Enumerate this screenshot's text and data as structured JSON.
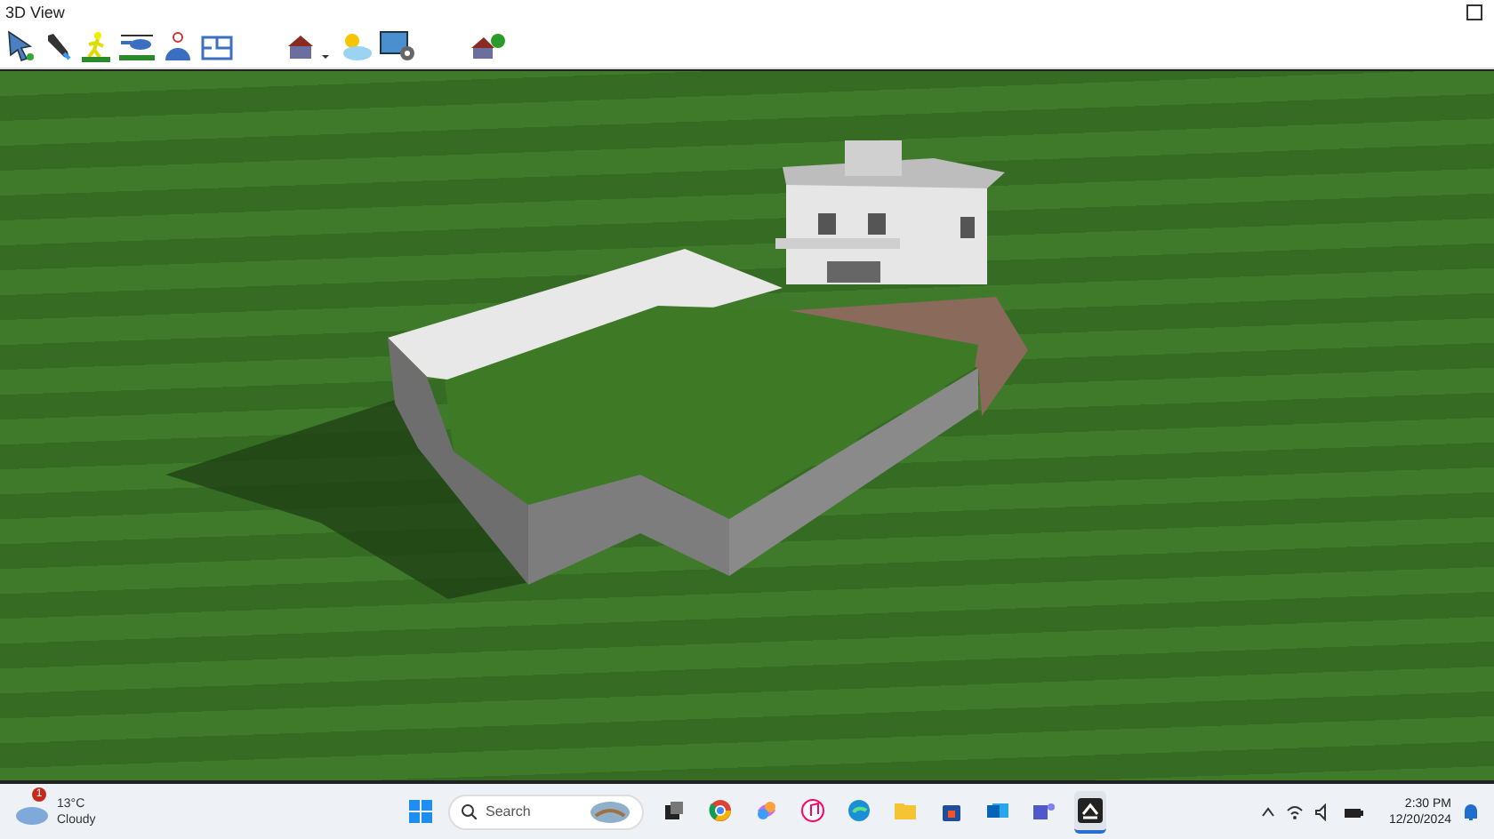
{
  "window": {
    "title": "3D View"
  },
  "taskbar": {
    "weather": {
      "badge": "1",
      "temperature": "13°C",
      "condition": "Cloudy"
    },
    "search": {
      "placeholder": "Search"
    },
    "apps": [
      {
        "kind": "window",
        "selected": false
      },
      {
        "kind": "browser",
        "selected": false
      },
      {
        "kind": "sparkle",
        "selected": false
      },
      {
        "kind": "music",
        "selected": false
      },
      {
        "kind": "globe",
        "selected": false
      },
      {
        "kind": "folder",
        "selected": false
      },
      {
        "kind": "bag",
        "selected": false
      },
      {
        "kind": "mail",
        "selected": false
      },
      {
        "kind": "people",
        "selected": false
      },
      {
        "kind": "app",
        "selected": true
      }
    ],
    "clock": {
      "time": "2:30 PM",
      "date": "12/20/2024"
    }
  }
}
